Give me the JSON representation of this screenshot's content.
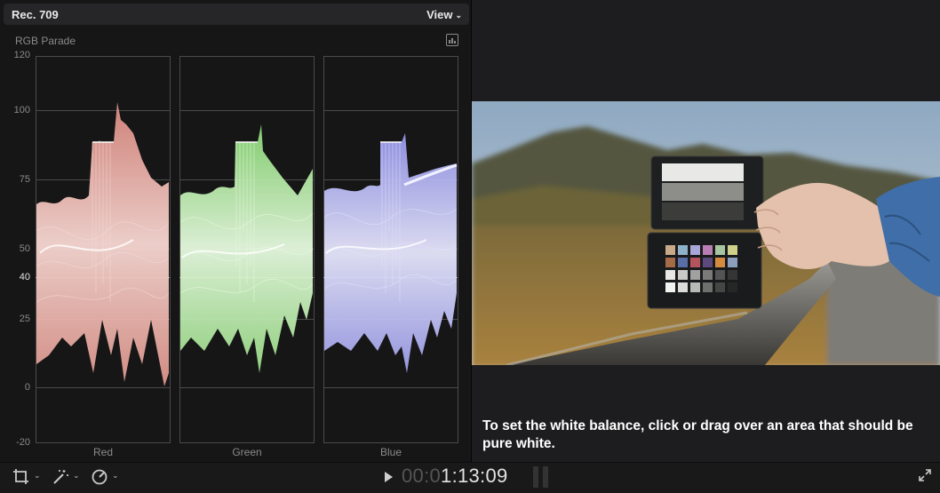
{
  "scopes": {
    "title": "Rec. 709",
    "view_label": "View",
    "scope_name": "RGB Parade",
    "axis": [
      "120",
      "100",
      "75",
      "50",
      "40",
      "25",
      "0",
      "-20"
    ],
    "channels": [
      "Red",
      "Green",
      "Blue"
    ],
    "channel_colors": [
      "#e7a49b",
      "#a4e58f",
      "#9fa0f5"
    ]
  },
  "viewer": {
    "hint_text": "To set the white balance, click or drag over an area that should be pure white."
  },
  "bottom_bar": {
    "timecode_dim": "00:0",
    "timecode_main": "1:13:09"
  }
}
